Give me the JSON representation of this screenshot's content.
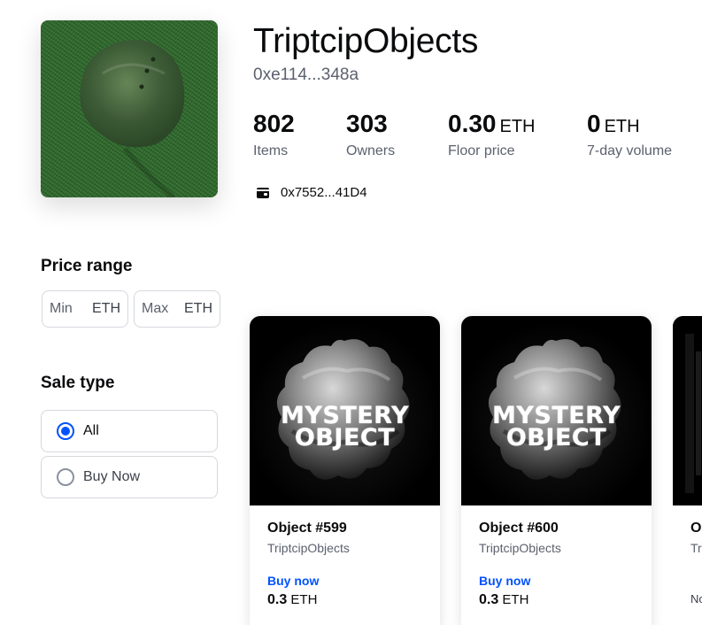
{
  "collection": {
    "name": "TriptcipObjects",
    "address": "0xe114...348a",
    "owner_address": "0x7552...41D4"
  },
  "stats": [
    {
      "value": "802",
      "unit": "",
      "label": "Items"
    },
    {
      "value": "303",
      "unit": "",
      "label": "Owners"
    },
    {
      "value": "0.30",
      "unit": "ETH",
      "label": "Floor price"
    },
    {
      "value": "0",
      "unit": "ETH",
      "label": "7-day volume"
    }
  ],
  "filters": {
    "price_range_title": "Price range",
    "min_placeholder": "Min",
    "max_placeholder": "Max",
    "currency": "ETH",
    "sale_type_title": "Sale type",
    "sale_options": [
      {
        "label": "All",
        "selected": true
      },
      {
        "label": "Buy Now",
        "selected": false
      }
    ]
  },
  "cards": [
    {
      "image_text": [
        "MYSTERY",
        "OBJECT"
      ],
      "name": "Object #599",
      "collection": "TriptcipObjects",
      "action": "Buy now",
      "price": "0.3",
      "currency": "ETH"
    },
    {
      "image_text": [
        "MYSTERY",
        "OBJECT"
      ],
      "name": "Object #600",
      "collection": "TriptcipObjects",
      "action": "Buy now",
      "price": "0.3",
      "currency": "ETH"
    },
    {
      "name": "O",
      "collection": "Tr",
      "action": "No"
    }
  ],
  "colors": {
    "accent": "#0052ff",
    "text": "#0a0b0d",
    "muted": "#5b616e",
    "border": "#d5d8dd"
  },
  "icons": {
    "owner": "wallet-icon",
    "radio_selected": "radio-selected-icon",
    "radio_unselected": "radio-unselected-icon"
  }
}
